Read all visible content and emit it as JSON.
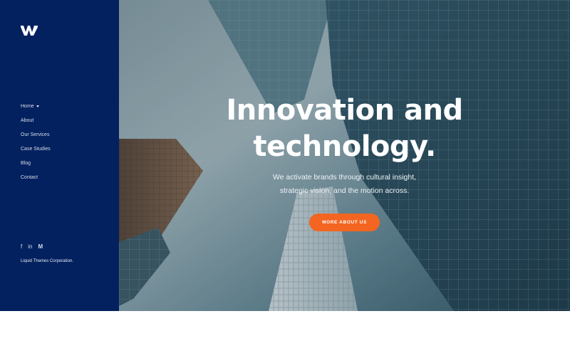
{
  "sidebar": {
    "logo_icon": "w-logo-icon",
    "nav": [
      {
        "label": "Home"
      },
      {
        "label": "About"
      },
      {
        "label": "Our Services"
      },
      {
        "label": "Case Studies"
      },
      {
        "label": "Blog"
      },
      {
        "label": "Contact"
      }
    ],
    "social": {
      "facebook": "f",
      "linkedin": "in",
      "medium": "M"
    },
    "copyright": "Liquid Themes Corporation."
  },
  "hero": {
    "headline_line1": "Innovation and",
    "headline_line2": "technology.",
    "sub_line1": "We activate brands through cultural insight,",
    "sub_line2": "strategic vision, and the motion across.",
    "cta_label": "MORE ABOUT US"
  },
  "colors": {
    "sidebar_bg": "#03215f",
    "cta": "#f36521",
    "text_white": "#ffffff"
  }
}
